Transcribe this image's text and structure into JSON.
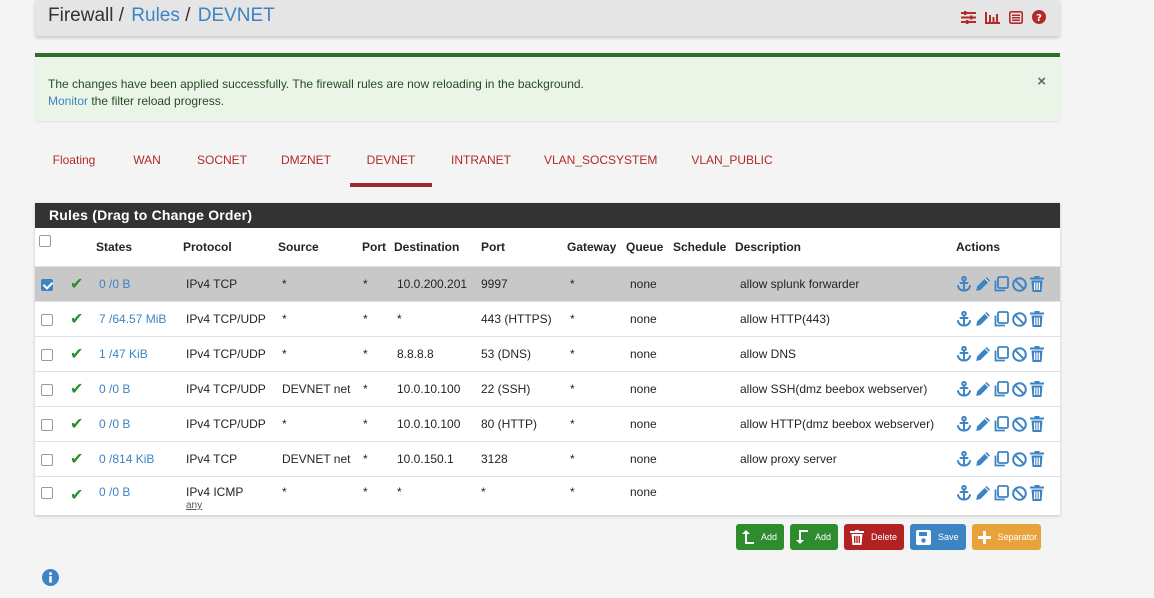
{
  "breadcrumb": {
    "part1": "Firewall",
    "sep1": "/",
    "part2": "Rules",
    "sep2": "/",
    "part3": "DEVNET"
  },
  "header_icons": [
    "sliders-icon",
    "bar-chart-icon",
    "list-icon",
    "help-icon"
  ],
  "alert": {
    "line1": "The changes have been applied successfully. The firewall rules are now reloading in the background.",
    "link": "Monitor",
    "line2_rest": " the filter reload progress.",
    "close": "×"
  },
  "tabs": [
    {
      "label": "Floating",
      "active": false
    },
    {
      "label": "WAN",
      "active": false
    },
    {
      "label": "SOCNET",
      "active": false
    },
    {
      "label": "DMZNET",
      "active": false
    },
    {
      "label": "DEVNET",
      "active": true
    },
    {
      "label": "INTRANET",
      "active": false
    },
    {
      "label": "VLAN_SOCSYSTEM",
      "active": false
    },
    {
      "label": "VLAN_PUBLIC",
      "active": false
    }
  ],
  "panel": {
    "title": "Rules (Drag to Change Order)",
    "columns": [
      "States",
      "Protocol",
      "Source",
      "Port",
      "Destination",
      "Port",
      "Gateway",
      "Queue",
      "Schedule",
      "Description",
      "Actions"
    ]
  },
  "rules": [
    {
      "checked": true,
      "states": "0 /0 B",
      "protocol": "IPv4 TCP",
      "protocol_sub": "",
      "source": "*",
      "sport": "*",
      "destination": "10.0.200.201",
      "dport": "9997",
      "gateway": "*",
      "queue": "none",
      "schedule": "",
      "description": "allow splunk forwarder"
    },
    {
      "checked": false,
      "states": "7 /64.57 MiB",
      "protocol": "IPv4 TCP/UDP",
      "protocol_sub": "",
      "source": "*",
      "sport": "*",
      "destination": "*",
      "dport": "443 (HTTPS)",
      "gateway": "*",
      "queue": "none",
      "schedule": "",
      "description": "allow HTTP(443)"
    },
    {
      "checked": false,
      "states": "1 /47 KiB",
      "protocol": "IPv4 TCP/UDP",
      "protocol_sub": "",
      "source": "*",
      "sport": "*",
      "destination": "8.8.8.8",
      "dport": "53 (DNS)",
      "gateway": "*",
      "queue": "none",
      "schedule": "",
      "description": "allow DNS"
    },
    {
      "checked": false,
      "states": "0 /0 B",
      "protocol": "IPv4 TCP/UDP",
      "protocol_sub": "",
      "source": "DEVNET net",
      "sport": "*",
      "destination": "10.0.10.100",
      "dport": "22 (SSH)",
      "gateway": "*",
      "queue": "none",
      "schedule": "",
      "description": "allow SSH(dmz beebox webserver)"
    },
    {
      "checked": false,
      "states": "0 /0 B",
      "protocol": "IPv4 TCP/UDP",
      "protocol_sub": "",
      "source": "*",
      "sport": "*",
      "destination": "10.0.10.100",
      "dport": "80 (HTTP)",
      "gateway": "*",
      "queue": "none",
      "schedule": "",
      "description": "allow HTTP(dmz beebox webserver)"
    },
    {
      "checked": false,
      "states": "0 /814 KiB",
      "protocol": "IPv4 TCP",
      "protocol_sub": "",
      "source": "DEVNET net",
      "sport": "*",
      "destination": "10.0.150.1",
      "dport": "3128",
      "gateway": "*",
      "queue": "none",
      "schedule": "",
      "description": "allow proxy server"
    },
    {
      "checked": false,
      "states": "0 /0 B",
      "protocol": "IPv4 ICMP",
      "protocol_sub": "any",
      "source": "*",
      "sport": "*",
      "destination": "*",
      "dport": "*",
      "gateway": "*",
      "queue": "none",
      "schedule": "",
      "description": ""
    }
  ],
  "row_actions": [
    "anchor-icon",
    "edit-icon",
    "copy-icon",
    "disable-icon",
    "delete-icon"
  ],
  "buttons": {
    "add_top": "Add",
    "add_bottom": "Add",
    "delete": "Delete",
    "save": "Save",
    "separator": "Separator"
  },
  "colors": {
    "accent_blue": "#3d84c4",
    "tab_red": "#b22a2a",
    "success_green": "#2e6f27",
    "panel_header": "#333333",
    "btn_orange": "#e8a23c"
  }
}
